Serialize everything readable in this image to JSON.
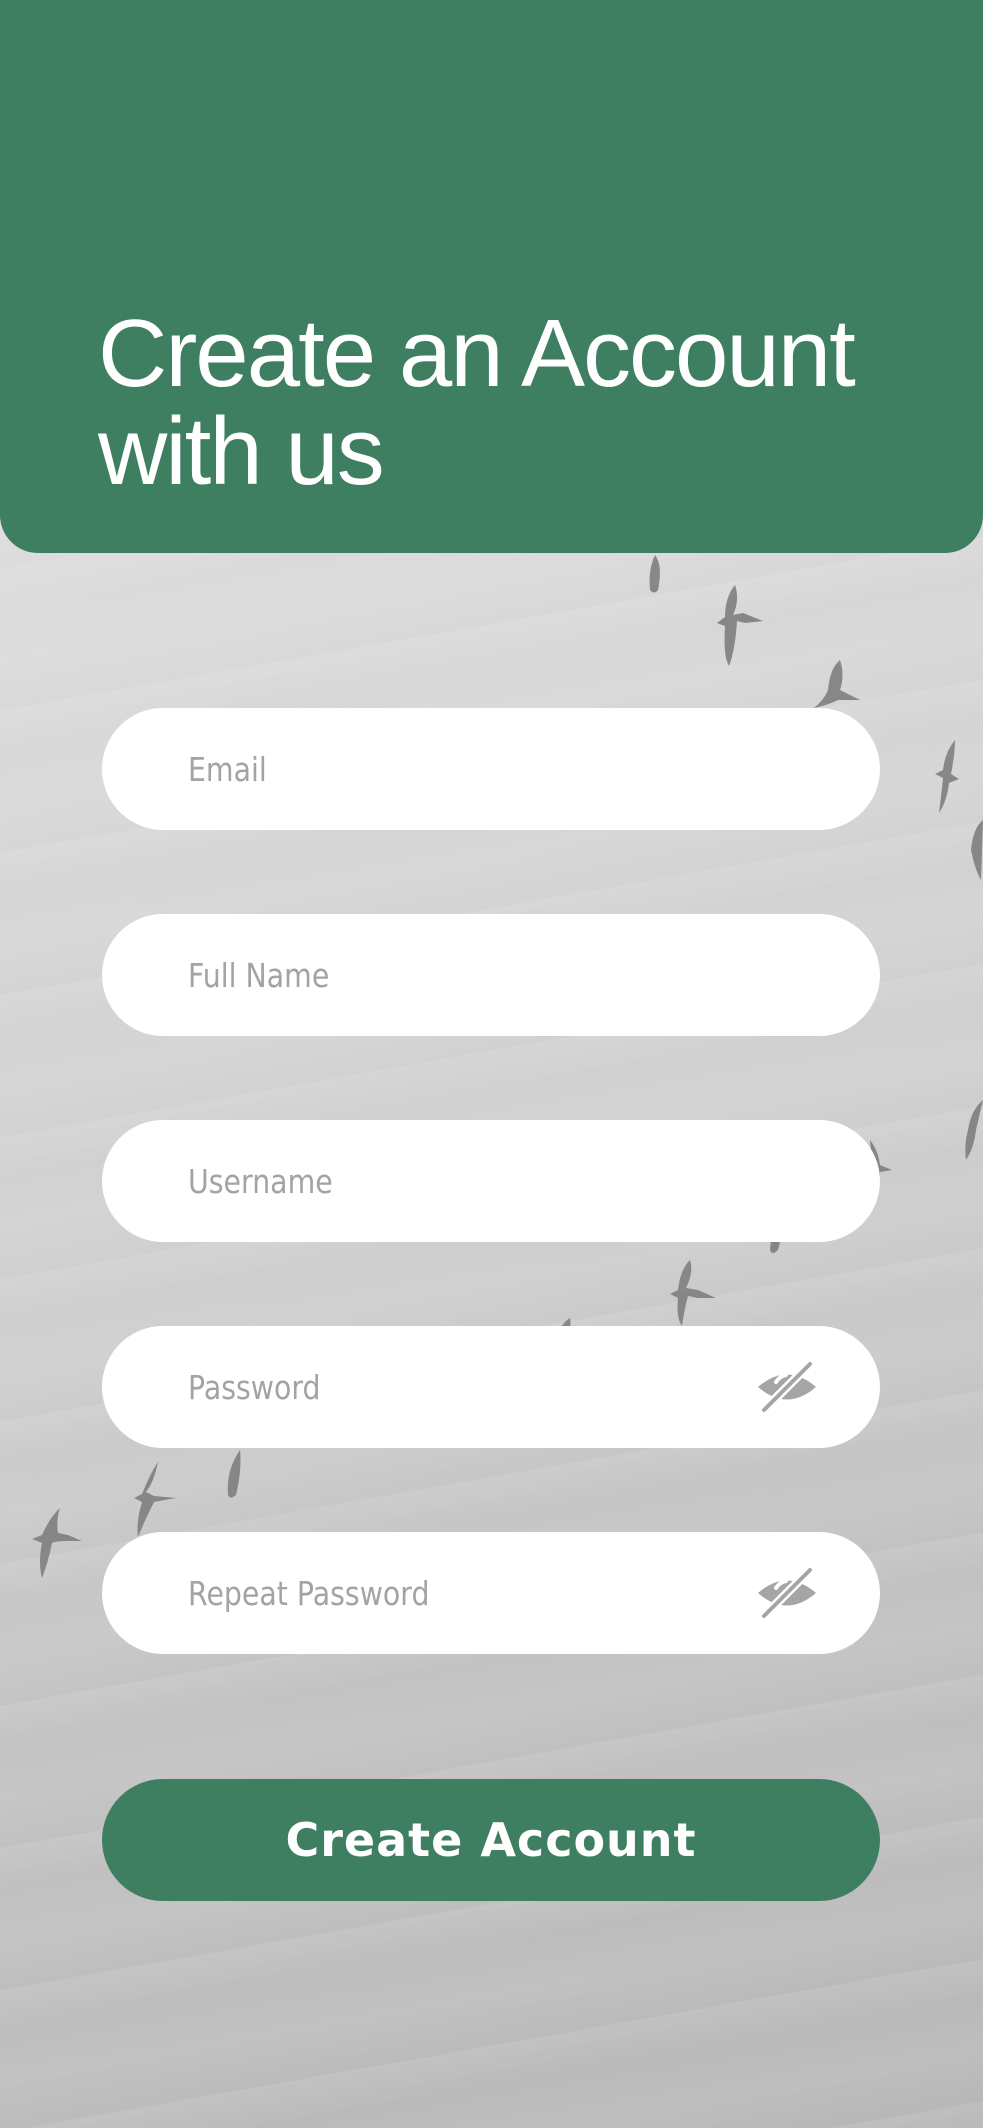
{
  "header": {
    "title_line1": "Create an Account",
    "title_line2": "with us"
  },
  "form": {
    "email_placeholder": "Email",
    "fullname_placeholder": "Full Name",
    "username_placeholder": "Username",
    "password_placeholder": "Password",
    "repeat_password_placeholder": "Repeat Password",
    "submit_label": "Create Account"
  },
  "icons": {
    "password_toggle": "eye-slash-icon",
    "repeat_password_toggle": "eye-slash-icon"
  },
  "colors": {
    "brand_green": "#3e7e61",
    "field_bg": "#ffffff",
    "placeholder_text": "#a3a3a3"
  }
}
